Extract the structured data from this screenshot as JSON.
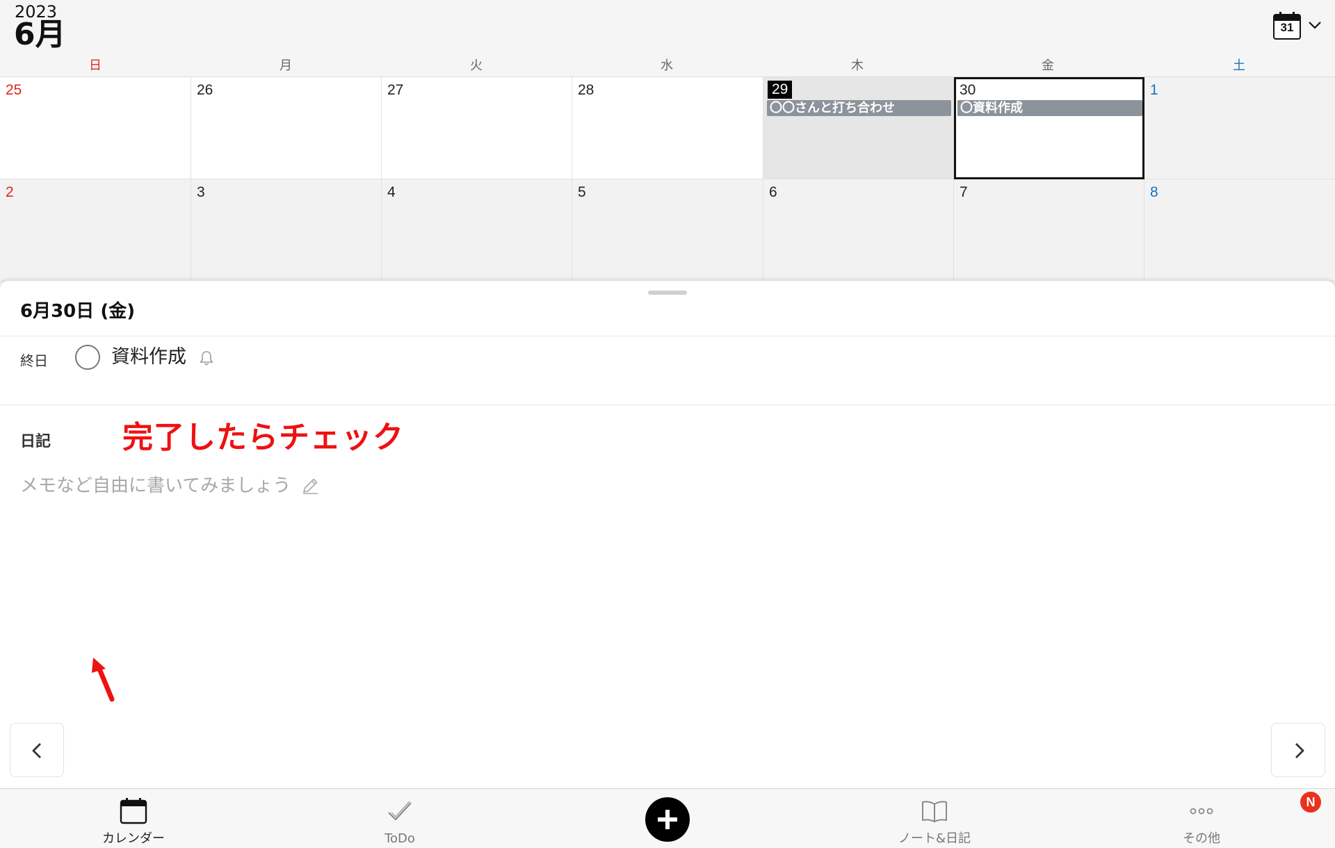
{
  "header": {
    "year": "2023",
    "month": "6月",
    "calendar_icon_day": "31"
  },
  "weekdays": [
    "日",
    "月",
    "火",
    "水",
    "木",
    "金",
    "土"
  ],
  "calendar": {
    "week1": [
      {
        "day": "25",
        "event": ""
      },
      {
        "day": "26",
        "event": ""
      },
      {
        "day": "27",
        "event": ""
      },
      {
        "day": "28",
        "event": ""
      },
      {
        "day": "29",
        "event": "〇〇さんと打ち合わせ"
      },
      {
        "day": "30",
        "event": "〇資料作成"
      },
      {
        "day": "1",
        "event": ""
      }
    ],
    "week2": [
      {
        "day": "2"
      },
      {
        "day": "3"
      },
      {
        "day": "4"
      },
      {
        "day": "5"
      },
      {
        "day": "6"
      },
      {
        "day": "7"
      },
      {
        "day": "8"
      }
    ],
    "today": "29",
    "selected": "30"
  },
  "sheet": {
    "date_title": "6月30日 (金)",
    "allday_label": "終日",
    "todo_title": "資料作成",
    "annotation": "完了したらチェック",
    "diary_label": "日記",
    "diary_placeholder": "メモなど自由に書いてみましょう"
  },
  "tabbar": {
    "calendar": "カレンダー",
    "todo": "ToDo",
    "notes": "ノート&日記",
    "other": "その他",
    "badge": "N"
  },
  "colors": {
    "sunday": "#e0261b",
    "saturday": "#1473c4",
    "event_bar": "#8c939a",
    "annotation": "#ee1111",
    "badge": "#e8321e"
  }
}
